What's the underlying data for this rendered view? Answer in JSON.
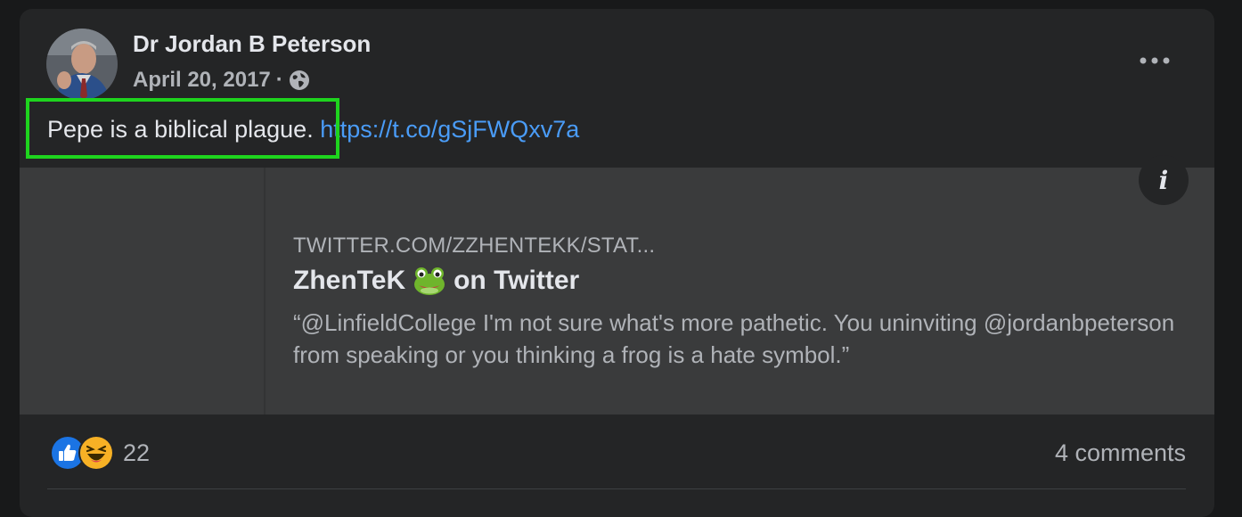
{
  "post": {
    "author": "Dr Jordan B Peterson",
    "date": "April 20, 2017",
    "separator": "·",
    "audience_icon": "globe-icon",
    "text": "Pepe is a biblical plague.",
    "link": "https://t.co/gSjFWQxv7a"
  },
  "link_preview": {
    "domain": "TWITTER.COM/ZZHENTEKK/STAT...",
    "title_before": "ZhenTeK",
    "title_emoji": "frog-emoji",
    "title_after": "on Twitter",
    "description": "“@LinfieldCollege I'm not sure what's more pathetic. You uninviting @jordanbpeterson from speaking or you thinking a frog is a hate symbol.”",
    "info_label": "i"
  },
  "footer": {
    "reaction_icons": [
      "like-icon",
      "haha-icon"
    ],
    "reaction_count": "22",
    "comments": "4 comments"
  },
  "colors": {
    "background": "#18191a",
    "card": "#242526",
    "preview": "#3a3b3c",
    "link": "#4a9cf7",
    "highlight": "#1ed41e",
    "text_primary": "#e4e6eb",
    "text_secondary": "#b0b3b8"
  }
}
